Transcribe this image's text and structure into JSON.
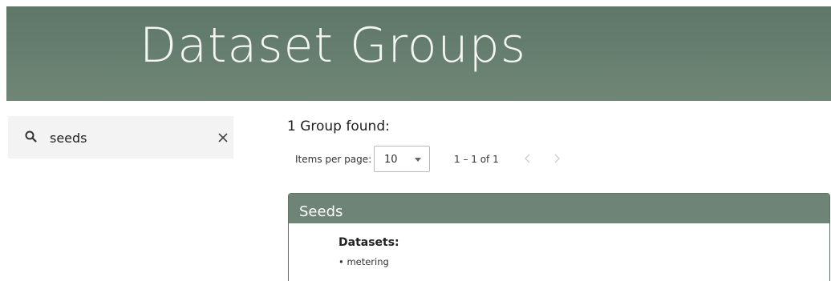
{
  "header": {
    "title": "Dataset Groups"
  },
  "search": {
    "value": "seeds",
    "icon": "search-icon",
    "clear_icon": "close-icon"
  },
  "results": {
    "summary": "1 Group found:"
  },
  "pager": {
    "items_per_page_label": "Items per page:",
    "items_per_page_value": "10",
    "range_label": "1 – 1 of 1",
    "prev_icon": "chevron-left-icon",
    "next_icon": "chevron-right-icon"
  },
  "groups": [
    {
      "title": "Seeds",
      "datasets_label": "Datasets:",
      "datasets": [
        "• metering"
      ]
    }
  ],
  "colors": {
    "banner": "#6a8172",
    "card_header": "#6e8476",
    "search_bg": "#f3f3f3"
  }
}
